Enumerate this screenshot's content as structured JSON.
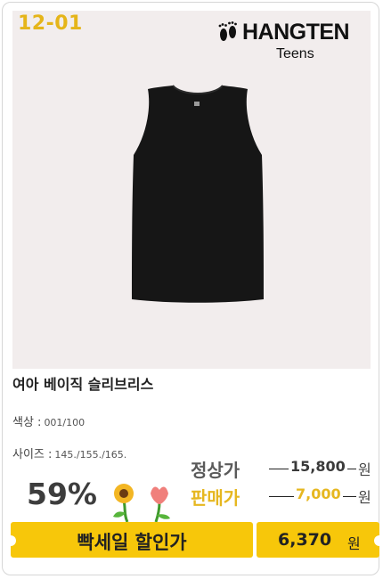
{
  "product": {
    "code": "12-01",
    "brand": {
      "name": "HANGTEN",
      "sub": "Teens"
    },
    "image_icon": "black-sleeveless-tank-top",
    "title": "여아 베이직 슬리브리스",
    "options": {
      "color_label": "색상 :",
      "color_value": "001/100",
      "size_label": "사이즈 :",
      "size_value": "145./155./165."
    }
  },
  "pricing": {
    "discount_rate": "59%",
    "regular_label": "정상가",
    "regular_price": "15,800",
    "sale_label": "판매가",
    "sale_price": "7,000",
    "unit": "원",
    "banner_text": "빡세일 할인가",
    "final_price": "6,370",
    "final_unit": "원"
  },
  "colors": {
    "accent_yellow": "#f7c70a",
    "code_gold": "#e5b51a",
    "photo_bg": "#f2eded"
  }
}
